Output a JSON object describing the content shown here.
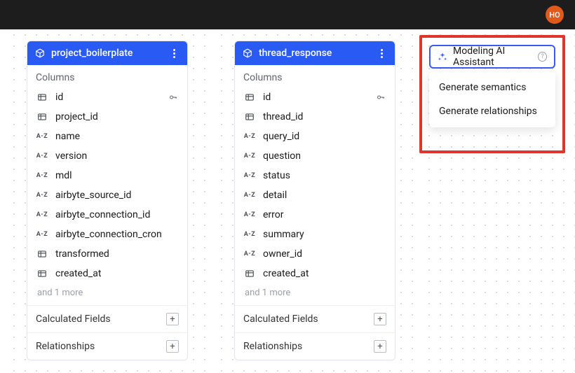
{
  "header": {
    "avatar_initials": "HO"
  },
  "tables": {
    "left": {
      "title": "project_boilerplate",
      "columns_label": "Columns",
      "columns": [
        {
          "name": "id",
          "type": "pk",
          "pk": true
        },
        {
          "name": "project_id",
          "type": "pk"
        },
        {
          "name": "name",
          "type": "text"
        },
        {
          "name": "version",
          "type": "text"
        },
        {
          "name": "mdl",
          "type": "text"
        },
        {
          "name": "airbyte_source_id",
          "type": "text"
        },
        {
          "name": "airbyte_connection_id",
          "type": "text"
        },
        {
          "name": "airbyte_connection_cron",
          "type": "text"
        },
        {
          "name": "transformed",
          "type": "pk"
        },
        {
          "name": "created_at",
          "type": "pk"
        }
      ],
      "more_label": "and 1 more",
      "calc_label": "Calculated Fields",
      "rel_label": "Relationships"
    },
    "mid": {
      "title": "thread_response",
      "columns_label": "Columns",
      "columns": [
        {
          "name": "id",
          "type": "pk",
          "pk": true
        },
        {
          "name": "thread_id",
          "type": "pk"
        },
        {
          "name": "query_id",
          "type": "text"
        },
        {
          "name": "question",
          "type": "text"
        },
        {
          "name": "status",
          "type": "text"
        },
        {
          "name": "detail",
          "type": "text"
        },
        {
          "name": "error",
          "type": "text"
        },
        {
          "name": "summary",
          "type": "text"
        },
        {
          "name": "owner_id",
          "type": "text"
        },
        {
          "name": "created_at",
          "type": "pk"
        }
      ],
      "more_label": "and 1 more",
      "calc_label": "Calculated Fields",
      "rel_label": "Relationships"
    }
  },
  "ai_assistant": {
    "button_label": "Modeling AI Assistant",
    "menu": {
      "semantics": "Generate semantics",
      "relationships": "Generate relationships"
    }
  }
}
